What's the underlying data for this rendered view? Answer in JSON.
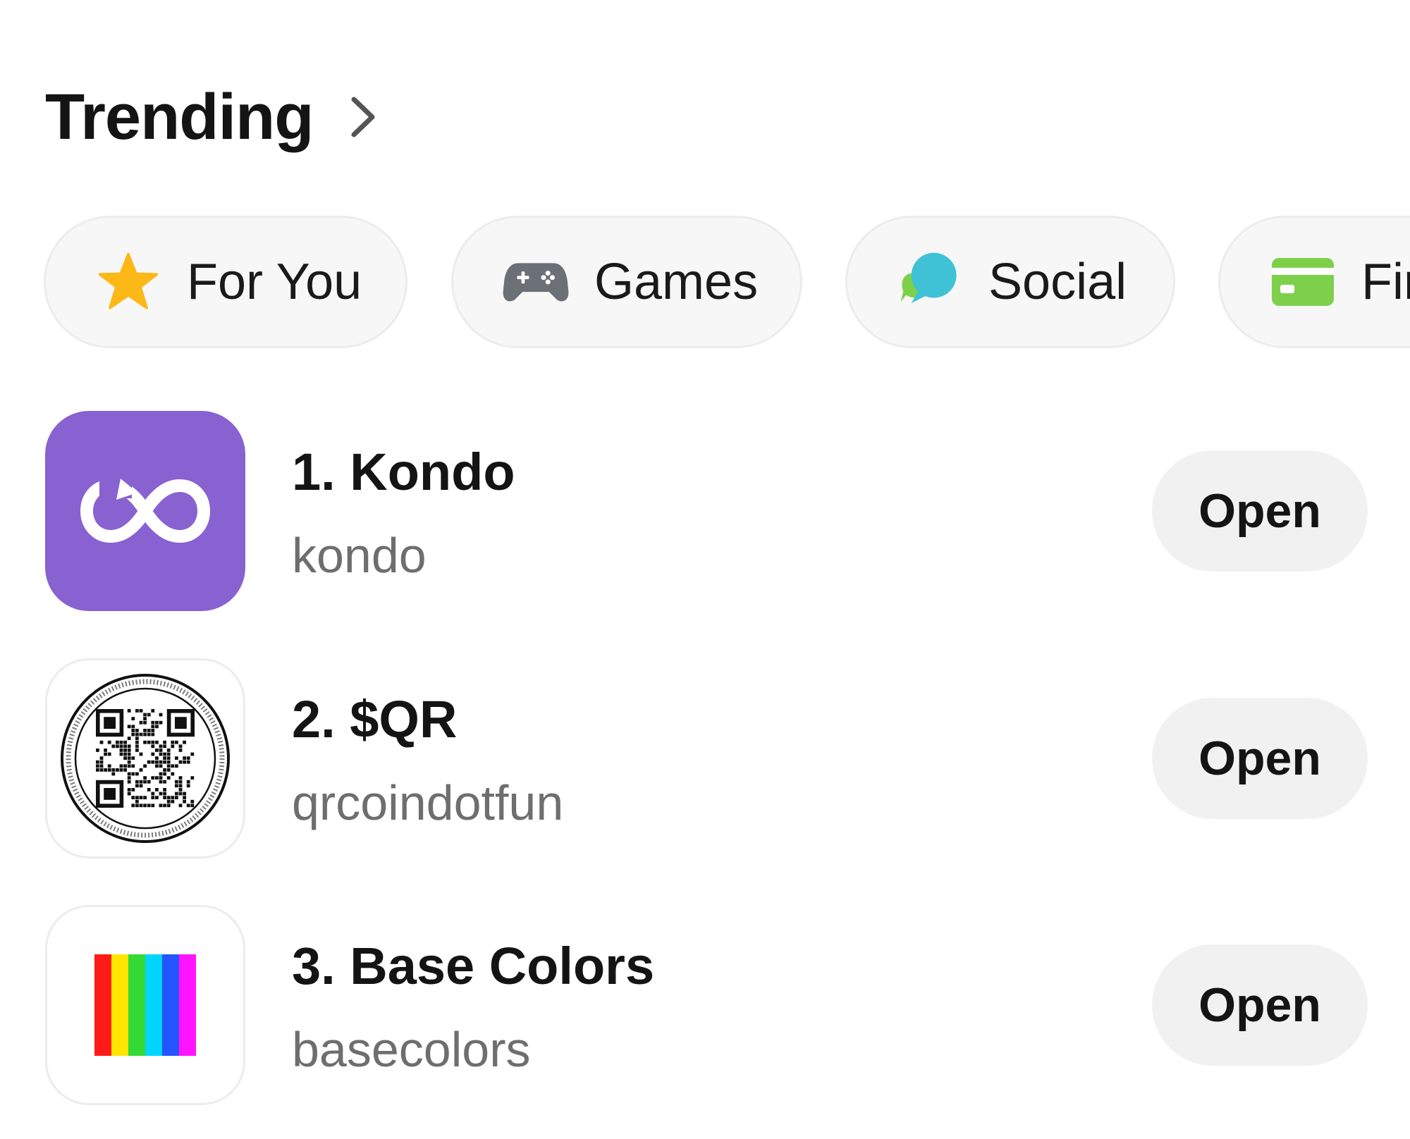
{
  "header": {
    "title": "Trending"
  },
  "categories": [
    {
      "label": "For You",
      "icon": "star-icon",
      "color": "#FBB817"
    },
    {
      "label": "Games",
      "icon": "gamepad-icon",
      "color": "#6B6F76"
    },
    {
      "label": "Social",
      "icon": "chat-bubbles-icon",
      "color": "#3FC2D6"
    },
    {
      "label": "Fir",
      "icon": "credit-card-icon",
      "color": "#7ED04B"
    }
  ],
  "apps": [
    {
      "name": "1. Kondo",
      "handle": "kondo",
      "action": "Open",
      "icon": "kondo-infinity-icon",
      "icon_bg": "#8762D0"
    },
    {
      "name": "2. $QR",
      "handle": "qrcoindotfun",
      "action": "Open",
      "icon": "qr-code-icon",
      "icon_bg": "#FFFFFF"
    },
    {
      "name": "3. Base Colors",
      "handle": "basecolors",
      "action": "Open",
      "icon": "rainbow-stripes-icon",
      "icon_bg": "#FFFFFF"
    }
  ],
  "colors": {
    "accent_purple": "#8762D0",
    "chip_bg": "#F7F7F7",
    "button_bg": "#F1F1F1",
    "text_primary": "#141414",
    "text_secondary": "#6E6E6E",
    "rainbow": [
      "#FF1A1A",
      "#FFE600",
      "#35D935",
      "#00D5FF",
      "#2454FF",
      "#FF14FF"
    ]
  }
}
